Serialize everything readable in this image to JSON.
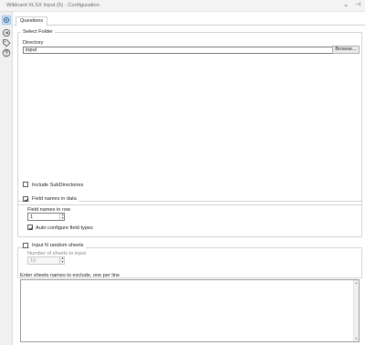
{
  "window": {
    "title": "Wildcard XLSX Input (5) - Configuration",
    "collapse_glyph": "⌄",
    "pin_glyph": "⊣"
  },
  "rail": {
    "icons": [
      {
        "name": "settings-icon",
        "active": true
      },
      {
        "name": "connection-icon",
        "active": false
      },
      {
        "name": "tag-icon",
        "active": false
      },
      {
        "name": "help-icon",
        "active": false
      }
    ]
  },
  "tabs": [
    {
      "label": "Questions",
      "active": true
    }
  ],
  "select_folder": {
    "title": "Select Folder",
    "directory_label": "Directory",
    "directory_value": "input",
    "browse_label": "Browse...",
    "include_subdirs_label": "Include SubDirectories",
    "include_subdirs_checked": false
  },
  "field_names": {
    "checkbox_label": "Field names in data",
    "checked": true,
    "row_label": "Field names in row",
    "row_value": "1",
    "auto_configure_label": "Auto configure field types",
    "auto_configure_checked": true
  },
  "random_sheets": {
    "checkbox_label": "Input N random sheets",
    "checked": false,
    "count_label": "Number of sheets to input",
    "count_value": "10"
  },
  "exclude": {
    "label": "Enter sheets names to exclude, one per line",
    "value": ""
  },
  "colors": {
    "accent_active": "#cfe2f7",
    "border": "#d4d4d4",
    "check": "#1a1a1a"
  }
}
